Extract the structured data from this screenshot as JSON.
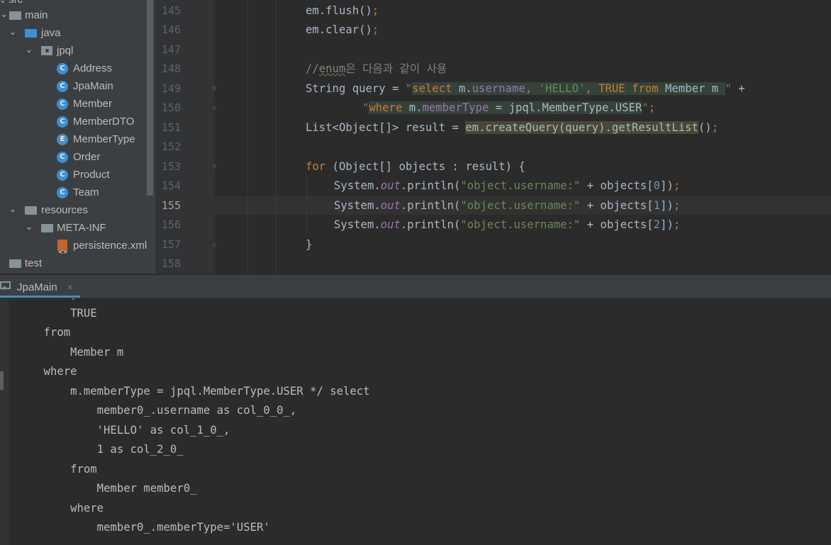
{
  "tree": {
    "items": [
      {
        "label": "src",
        "type": "folder"
      },
      {
        "label": "main",
        "type": "folder"
      },
      {
        "label": "java",
        "type": "folder-blue"
      },
      {
        "label": "jpql",
        "type": "package"
      },
      {
        "label": "Address",
        "type": "class",
        "badge": "C"
      },
      {
        "label": "JpaMain",
        "type": "class",
        "badge": "C"
      },
      {
        "label": "Member",
        "type": "class",
        "badge": "C"
      },
      {
        "label": "MemberDTO",
        "type": "class",
        "badge": "C"
      },
      {
        "label": "MemberType",
        "type": "enum",
        "badge": "E"
      },
      {
        "label": "Order",
        "type": "class",
        "badge": "C"
      },
      {
        "label": "Product",
        "type": "class",
        "badge": "C"
      },
      {
        "label": "Team",
        "type": "class",
        "badge": "C"
      },
      {
        "label": "resources",
        "type": "folder"
      },
      {
        "label": "META-INF",
        "type": "folder"
      },
      {
        "label": "persistence.xml",
        "type": "xml"
      },
      {
        "label": "test",
        "type": "folder"
      }
    ]
  },
  "editor": {
    "current_line": "155",
    "line_numbers": [
      "145",
      "146",
      "147",
      "148",
      "149",
      "150",
      "151",
      "152",
      "153",
      "154",
      "155",
      "156",
      "157",
      "158"
    ],
    "code": {
      "l145_a": "em.flush",
      "l145_b": "()",
      "l145_c": ";",
      "l146_a": "em.clear",
      "l146_b": "()",
      "l146_c": ";",
      "l148_a": "//",
      "l148_b": "enum",
      "l148_c": "은 다음과 같이 사용",
      "l149_a": "String query = ",
      "l149_q1": "\"",
      "l149_s1": "select",
      "l149_s2": " m.",
      "l149_s3": "username",
      "l149_s4": ", ",
      "l149_s5": "'HELLO'",
      "l149_s6": ", ",
      "l149_s7": "TRUE",
      "l149_s8": " ",
      "l149_s9": "from",
      "l149_s10": " Member m ",
      "l149_q2": "\"",
      "l149_plus": " +",
      "l150_q1": "\"",
      "l150_s1": "where",
      "l150_s2": " m.",
      "l150_s3": "memberType",
      "l150_s4": " = jpql.MemberType.USER",
      "l150_q2": "\"",
      "l150_end": ";",
      "l151_a": "List<Object[]> result = ",
      "l151_b": "em.createQuery(query).getResultList",
      "l151_c": "()",
      "l151_d": ";",
      "l153_a": "for",
      "l153_b": " (Object[] objects : result) {",
      "l154_a": "System.",
      "l154_b": "out",
      "l154_c": ".println(",
      "l154_d": "\"object.username:\"",
      "l154_e": " + objects[",
      "l154_f": "0",
      "l154_g": "])",
      "l154_h": ";",
      "l155_f": "1",
      "l156_f": "2",
      "l157_a": "}"
    }
  },
  "run_panel": {
    "tab_label": "JpaMain",
    "close_glyph": "×",
    "output": [
      "        ,",
      "        TRUE",
      "    from",
      "        Member m",
      "    where",
      "        m.memberType = jpql.MemberType.USER */ select",
      "            member0_.username as col_0_0_,",
      "            'HELLO' as col_1_0_,",
      "            1 as col_2_0_",
      "        from",
      "            Member member0_",
      "        where",
      "            member0_.memberType='USER'"
    ]
  },
  "colors": {
    "keyword": "#cc7832",
    "string": "#6a8759",
    "comment": "#808080",
    "field": "#9876aa",
    "number": "#6897bb",
    "background": "#2b2b2b",
    "tab_underline": "#4a88c7"
  }
}
